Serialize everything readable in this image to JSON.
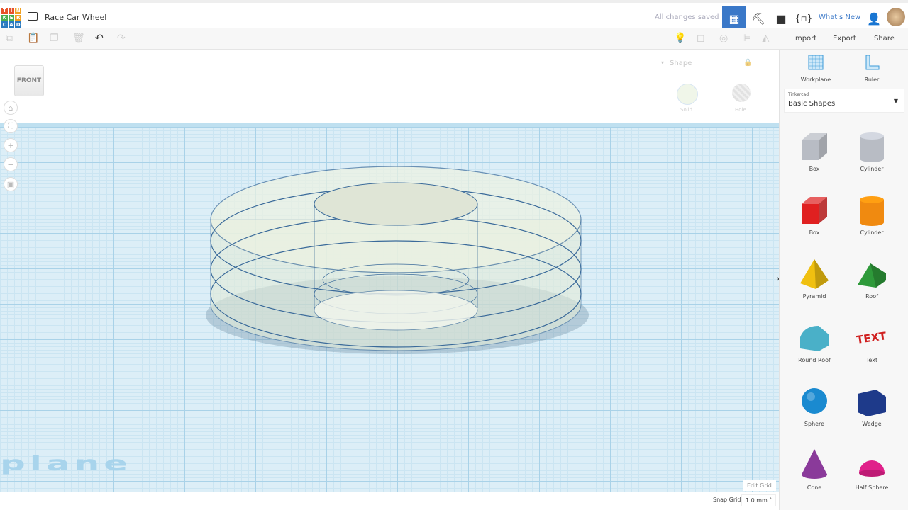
{
  "header": {
    "logo": [
      "T",
      "I",
      "N",
      "K",
      "E",
      "R",
      "C",
      "A",
      "D"
    ],
    "title": "Race Car Wheel",
    "status": "All changes saved",
    "whats_new": "What's New"
  },
  "toolbar": {
    "import": "Import",
    "export": "Export",
    "share": "Share"
  },
  "viewport": {
    "view_cube": "FRONT",
    "workplane_watermark": "plane",
    "edit_grid": "Edit Grid",
    "snap_grid_label": "Snap Grid",
    "snap_grid_value": "1.0 mm ˄"
  },
  "inspector": {
    "title": "Shape",
    "solid": "Solid",
    "hole": "Hole"
  },
  "sidebar": {
    "workplane": "Workplane",
    "ruler": "Ruler",
    "library_source": "Tinkercad",
    "library": "Basic Shapes",
    "shapes": [
      {
        "label": "Box",
        "color": "#b8bcc4"
      },
      {
        "label": "Cylinder",
        "color": "#b8bcc4"
      },
      {
        "label": "Box",
        "color": "#e02020"
      },
      {
        "label": "Cylinder",
        "color": "#f08a10"
      },
      {
        "label": "Pyramid",
        "color": "#f0c010"
      },
      {
        "label": "Roof",
        "color": "#2e9a3a"
      },
      {
        "label": "Round Roof",
        "color": "#4ab0c8"
      },
      {
        "label": "Text",
        "color": "#d02020"
      },
      {
        "label": "Sphere",
        "color": "#1a8ad0"
      },
      {
        "label": "Wedge",
        "color": "#1e3a8a"
      },
      {
        "label": "Cone",
        "color": "#8a3a9a"
      },
      {
        "label": "Half Sphere",
        "color": "#e0208a"
      }
    ]
  },
  "colors": {
    "accent": "#3a78c8",
    "grid": "#dceef7"
  }
}
